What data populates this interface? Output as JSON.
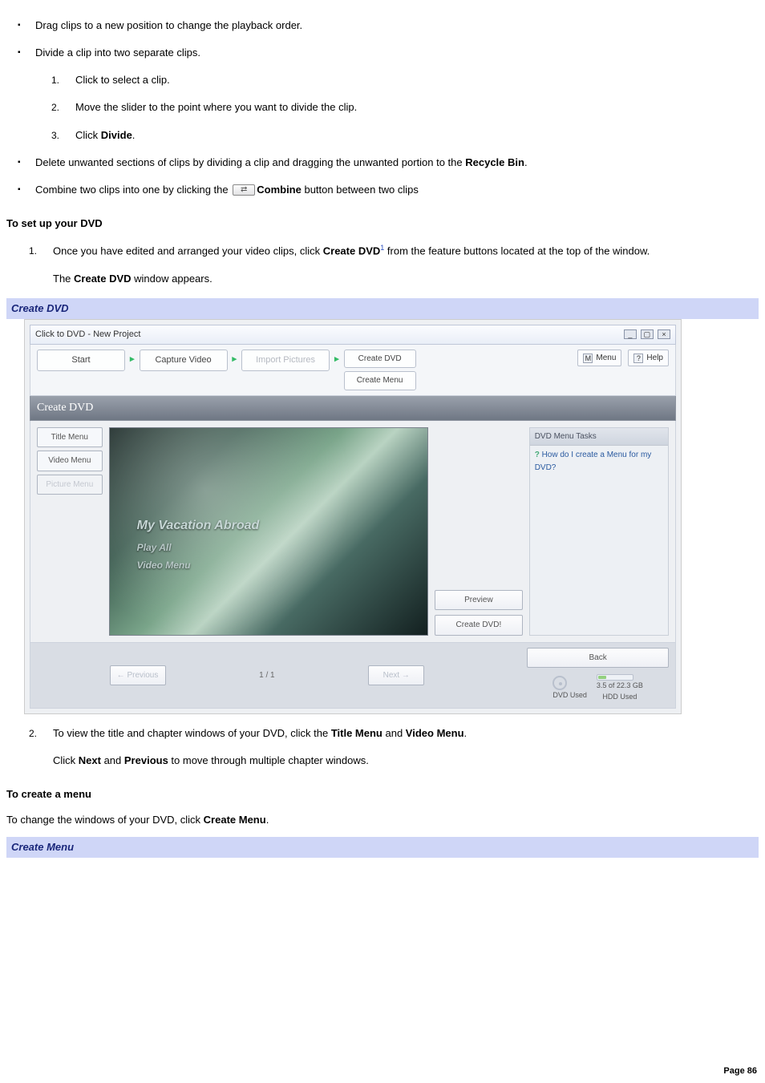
{
  "bullets": {
    "drag": "Drag clips to a new position to change the playback order.",
    "divide_intro": "Divide a clip into two separate clips.",
    "divide_steps": {
      "s1": "Click to select a clip.",
      "s2": "Move the slider to the point where you want to divide the clip.",
      "s3_a": "Click ",
      "s3_b": "Divide",
      "s3_c": "."
    },
    "delete_a": "Delete unwanted sections of clips by dividing a clip and dragging the unwanted portion to the ",
    "delete_b": "Recycle Bin",
    "delete_c": ".",
    "combine_a": "Combine two clips into one by clicking the ",
    "combine_b": "Combine",
    "combine_c": " button between two clips"
  },
  "setup": {
    "heading": "To set up your DVD",
    "step1_a": "Once you have edited and arranged your video clips, click ",
    "step1_b": "Create DVD",
    "step1_sup": "1",
    "step1_c": " from the feature buttons located at the top of the window.",
    "result_a": "The ",
    "result_b": "Create DVD",
    "result_c": " window appears."
  },
  "fig1_caption": "Create DVD",
  "appshot": {
    "window_title": "Click to DVD - New Project",
    "win_min": "_",
    "win_max": "▢",
    "win_close": "×",
    "crumb": {
      "start": "Start",
      "capture": "Capture Video",
      "import": "Import Pictures",
      "create_dvd": "Create DVD",
      "create_menu": "Create Menu"
    },
    "top_right": {
      "menu_glyph": "M",
      "menu": "Menu",
      "help_glyph": "?",
      "help": "Help"
    },
    "section_title": "Create DVD",
    "menu_tabs": {
      "title": "Title Menu",
      "video": "Video Menu",
      "picture": "Picture Menu"
    },
    "preview_overlay": {
      "title": "My Vacation Abroad",
      "playall": "Play All",
      "videomenu": "Video Menu"
    },
    "side_buttons": {
      "preview": "Preview",
      "create": "Create DVD!"
    },
    "task_pane": {
      "header": "DVD Menu Tasks",
      "link": "How do I create a Menu for my DVD?"
    },
    "pager": {
      "prev": "← Previous",
      "count": "1 / 1",
      "next": "Next →"
    },
    "back": "Back",
    "usage": {
      "dvd_used": "DVD Used",
      "hdd_stat": "3.5 of 22.3 GB",
      "hdd_used": "HDD Used"
    }
  },
  "step2": {
    "a": "To view the title and chapter windows of your DVD, click the ",
    "b": "Title Menu",
    "c": " and ",
    "d": "Video Menu",
    "e": ".",
    "p2_a": "Click ",
    "p2_b": "Next",
    "p2_c": " and ",
    "p2_d": "Previous",
    "p2_e": " to move through multiple chapter windows."
  },
  "create_menu": {
    "heading": "To create a menu",
    "body_a": "To change the windows of your DVD, click ",
    "body_b": "Create Menu",
    "body_c": "."
  },
  "fig2_caption": "Create Menu",
  "footer": "Page 86"
}
